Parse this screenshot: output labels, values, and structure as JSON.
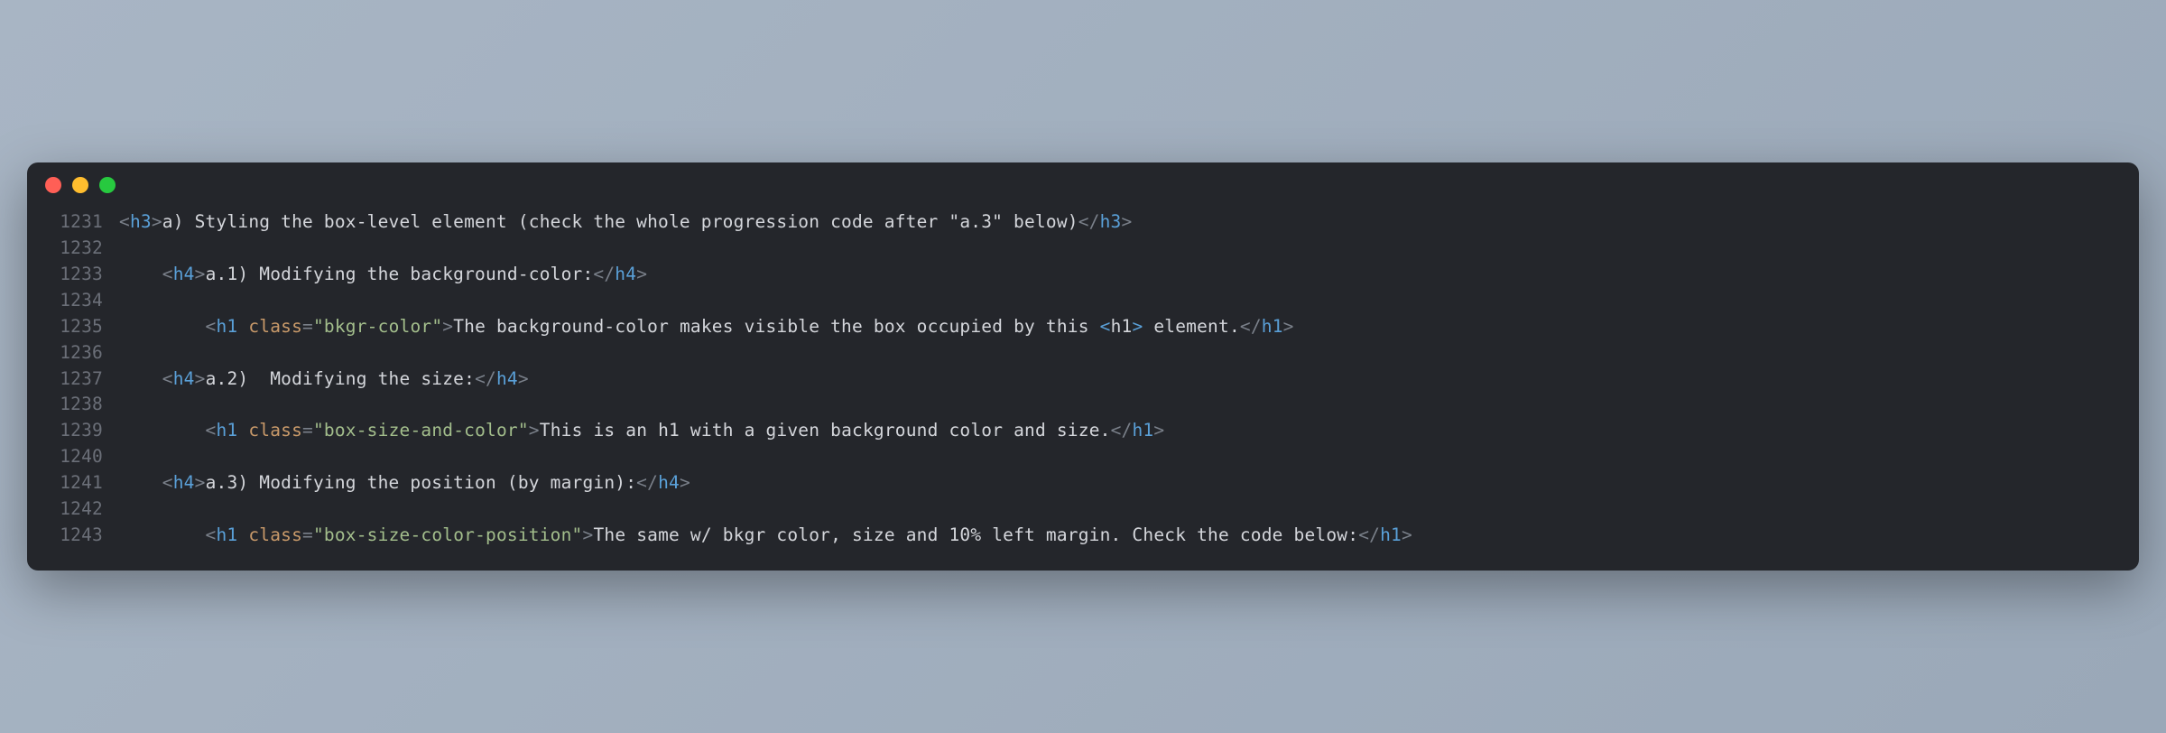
{
  "window": {
    "traffic_lights": [
      "close",
      "minimize",
      "maximize"
    ]
  },
  "code": {
    "lines": [
      {
        "num": "1231",
        "indent": "",
        "tokens": [
          {
            "t": "punct",
            "v": "<"
          },
          {
            "t": "tag",
            "v": "h3"
          },
          {
            "t": "punct",
            "v": ">"
          },
          {
            "t": "text",
            "v": "a) Styling the box-level element (check the whole progression code after \"a.3\" below)"
          },
          {
            "t": "punct",
            "v": "</"
          },
          {
            "t": "tag",
            "v": "h3"
          },
          {
            "t": "punct",
            "v": ">"
          }
        ]
      },
      {
        "num": "1232",
        "indent": "",
        "tokens": []
      },
      {
        "num": "1233",
        "indent": "    ",
        "tokens": [
          {
            "t": "punct",
            "v": "<"
          },
          {
            "t": "tag",
            "v": "h4"
          },
          {
            "t": "punct",
            "v": ">"
          },
          {
            "t": "text",
            "v": "a.1) Modifying the background-color:"
          },
          {
            "t": "punct",
            "v": "</"
          },
          {
            "t": "tag",
            "v": "h4"
          },
          {
            "t": "punct",
            "v": ">"
          }
        ]
      },
      {
        "num": "1234",
        "indent": "",
        "tokens": []
      },
      {
        "num": "1235",
        "indent": "        ",
        "tokens": [
          {
            "t": "punct",
            "v": "<"
          },
          {
            "t": "tag",
            "v": "h1"
          },
          {
            "t": "text",
            "v": " "
          },
          {
            "t": "attr",
            "v": "class"
          },
          {
            "t": "punct",
            "v": "="
          },
          {
            "t": "string",
            "v": "\"bkgr-color\""
          },
          {
            "t": "punct",
            "v": ">"
          },
          {
            "t": "text",
            "v": "The background-color makes visible the box occupied by this "
          },
          {
            "t": "entity",
            "v": "&lt;"
          },
          {
            "t": "text",
            "v": "h1"
          },
          {
            "t": "entity",
            "v": "&gt;"
          },
          {
            "t": "text",
            "v": " element."
          },
          {
            "t": "punct",
            "v": "</"
          },
          {
            "t": "tag",
            "v": "h1"
          },
          {
            "t": "punct",
            "v": ">"
          }
        ]
      },
      {
        "num": "1236",
        "indent": "",
        "tokens": []
      },
      {
        "num": "1237",
        "indent": "    ",
        "tokens": [
          {
            "t": "punct",
            "v": "<"
          },
          {
            "t": "tag",
            "v": "h4"
          },
          {
            "t": "punct",
            "v": ">"
          },
          {
            "t": "text",
            "v": "a.2)  Modifying the size:"
          },
          {
            "t": "punct",
            "v": "</"
          },
          {
            "t": "tag",
            "v": "h4"
          },
          {
            "t": "punct",
            "v": ">"
          }
        ]
      },
      {
        "num": "1238",
        "indent": "",
        "tokens": []
      },
      {
        "num": "1239",
        "indent": "        ",
        "tokens": [
          {
            "t": "punct",
            "v": "<"
          },
          {
            "t": "tag",
            "v": "h1"
          },
          {
            "t": "text",
            "v": " "
          },
          {
            "t": "attr",
            "v": "class"
          },
          {
            "t": "punct",
            "v": "="
          },
          {
            "t": "string",
            "v": "\"box-size-and-color\""
          },
          {
            "t": "punct",
            "v": ">"
          },
          {
            "t": "text",
            "v": "This is an h1 with a given background color and size."
          },
          {
            "t": "punct",
            "v": "</"
          },
          {
            "t": "tag",
            "v": "h1"
          },
          {
            "t": "punct",
            "v": ">"
          }
        ]
      },
      {
        "num": "1240",
        "indent": "",
        "tokens": []
      },
      {
        "num": "1241",
        "indent": "    ",
        "tokens": [
          {
            "t": "punct",
            "v": "<"
          },
          {
            "t": "tag",
            "v": "h4"
          },
          {
            "t": "punct",
            "v": ">"
          },
          {
            "t": "text",
            "v": "a.3) Modifying the position (by margin):"
          },
          {
            "t": "punct",
            "v": "</"
          },
          {
            "t": "tag",
            "v": "h4"
          },
          {
            "t": "punct",
            "v": ">"
          }
        ]
      },
      {
        "num": "1242",
        "indent": "",
        "tokens": []
      },
      {
        "num": "1243",
        "indent": "        ",
        "tokens": [
          {
            "t": "punct",
            "v": "<"
          },
          {
            "t": "tag",
            "v": "h1"
          },
          {
            "t": "text",
            "v": " "
          },
          {
            "t": "attr",
            "v": "class"
          },
          {
            "t": "punct",
            "v": "="
          },
          {
            "t": "string",
            "v": "\"box-size-color-position\""
          },
          {
            "t": "punct",
            "v": ">"
          },
          {
            "t": "text",
            "v": "The same w/ bkgr color, size and 10% left margin. Check the code below:"
          },
          {
            "t": "punct",
            "v": "</"
          },
          {
            "t": "tag",
            "v": "h1"
          },
          {
            "t": "punct",
            "v": ">"
          }
        ]
      }
    ]
  }
}
